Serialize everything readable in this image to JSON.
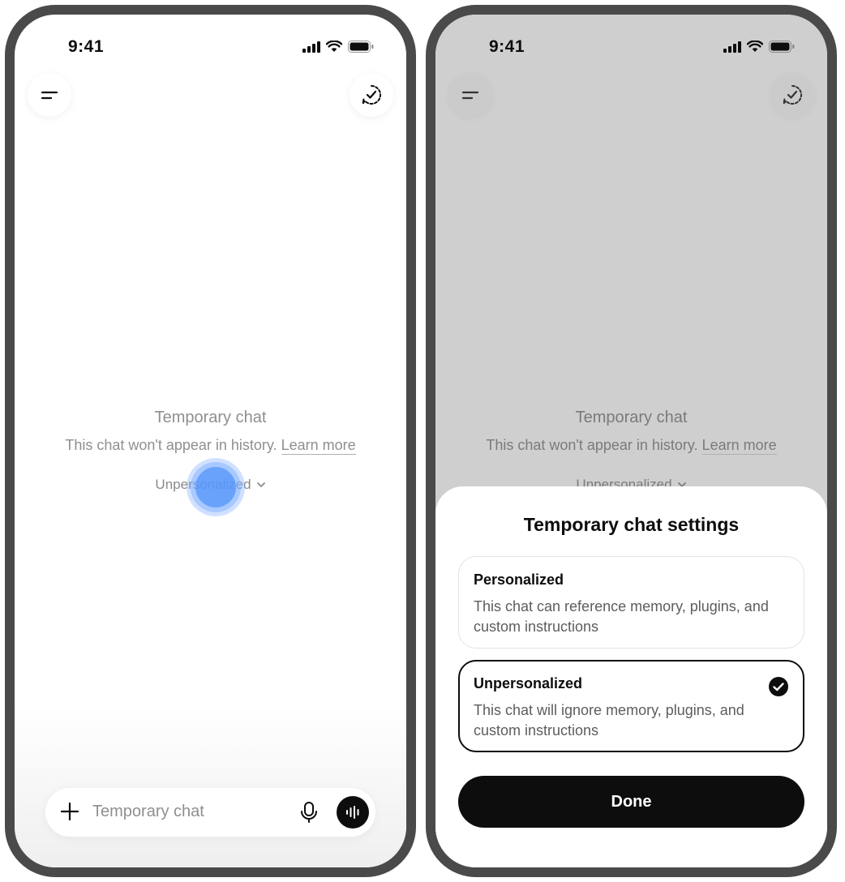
{
  "colors": {
    "frame": "#4a4a4a",
    "accent_dark": "#0d0d0d",
    "dimmed_background": "#cfcfcf",
    "tap_indicator": "#5696fa"
  },
  "left_screen": {
    "status_bar": {
      "time": "9:41",
      "icons": [
        "cellular-signal-icon",
        "wifi-icon",
        "battery-icon"
      ]
    },
    "top_bar": {
      "menu_icon": "menu-icon",
      "temporary_chat_icon": "temporary-chat-check-icon"
    },
    "center": {
      "title": "Temporary chat",
      "subtitle": "This chat won't appear in history.",
      "learn_more": "Learn more",
      "mode_label": "Unpersonalized"
    },
    "composer": {
      "placeholder": "Temporary chat",
      "plus_icon": "plus-icon",
      "mic_icon": "microphone-icon",
      "voice_icon": "voice-waveform-icon"
    }
  },
  "right_screen": {
    "status_bar": {
      "time": "9:41"
    },
    "center": {
      "title": "Temporary chat",
      "subtitle": "This chat won't appear in history.",
      "learn_more": "Learn more",
      "mode_label": "Unpersonalized"
    },
    "sheet": {
      "title": "Temporary chat settings",
      "options": [
        {
          "title": "Personalized",
          "description": "This chat can reference memory, plugins, and custom instructions",
          "selected": false
        },
        {
          "title": "Unpersonalized",
          "description": "This chat will ignore memory, plugins, and custom instructions",
          "selected": true
        }
      ],
      "done_label": "Done"
    }
  }
}
